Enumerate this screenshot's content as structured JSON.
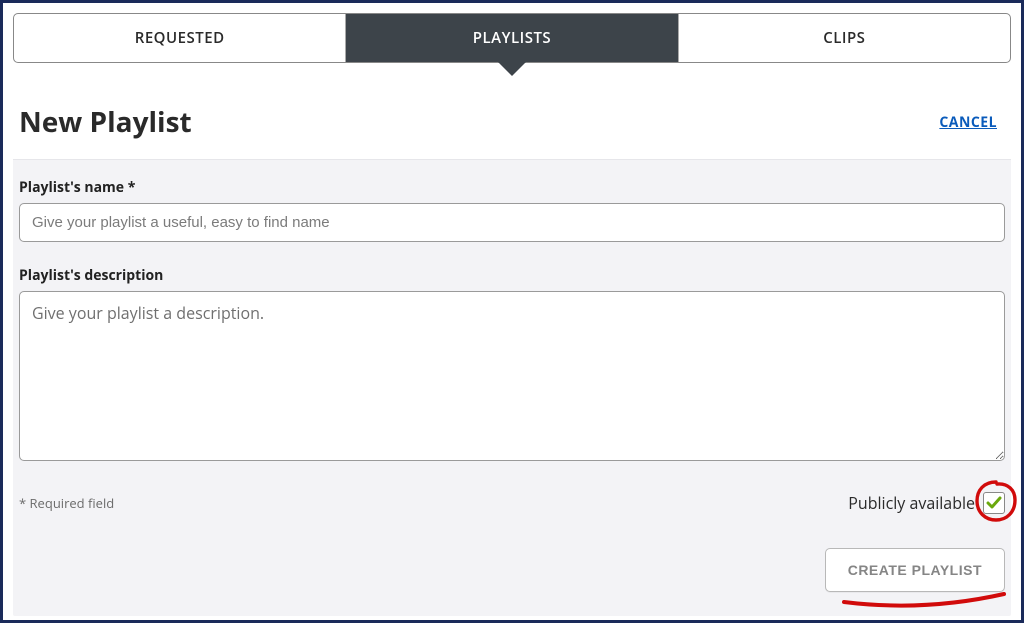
{
  "tabs": {
    "requested": "REQUESTED",
    "playlists": "PLAYLISTS",
    "clips": "CLIPS",
    "active": "playlists"
  },
  "page": {
    "title": "New Playlist",
    "cancel": "CANCEL"
  },
  "form": {
    "name_label": "Playlist's name  *",
    "name_placeholder": "Give your playlist a useful, easy to find name",
    "name_value": "",
    "desc_label": "Playlist's description",
    "desc_placeholder": "Give your playlist a description.",
    "desc_value": "",
    "required_note": "* Required field",
    "public_label": "Publicly available",
    "public_checked": true,
    "submit_label": "CREATE PLAYLIST"
  },
  "annotations": {
    "circle_color": "#d10b0b",
    "underline_color": "#d10b0b"
  }
}
